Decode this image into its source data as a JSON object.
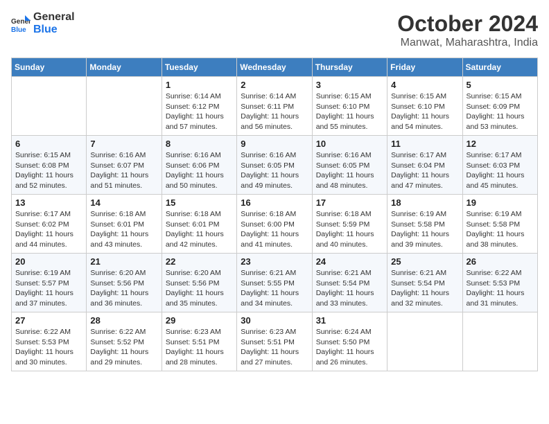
{
  "header": {
    "logo_line1": "General",
    "logo_line2": "Blue",
    "month": "October 2024",
    "location": "Manwat, Maharashtra, India"
  },
  "weekdays": [
    "Sunday",
    "Monday",
    "Tuesday",
    "Wednesday",
    "Thursday",
    "Friday",
    "Saturday"
  ],
  "weeks": [
    [
      null,
      null,
      {
        "day": "1",
        "sunrise": "6:14 AM",
        "sunset": "6:12 PM",
        "daylight": "11 hours and 57 minutes."
      },
      {
        "day": "2",
        "sunrise": "6:14 AM",
        "sunset": "6:11 PM",
        "daylight": "11 hours and 56 minutes."
      },
      {
        "day": "3",
        "sunrise": "6:15 AM",
        "sunset": "6:10 PM",
        "daylight": "11 hours and 55 minutes."
      },
      {
        "day": "4",
        "sunrise": "6:15 AM",
        "sunset": "6:10 PM",
        "daylight": "11 hours and 54 minutes."
      },
      {
        "day": "5",
        "sunrise": "6:15 AM",
        "sunset": "6:09 PM",
        "daylight": "11 hours and 53 minutes."
      }
    ],
    [
      {
        "day": "6",
        "sunrise": "6:15 AM",
        "sunset": "6:08 PM",
        "daylight": "11 hours and 52 minutes."
      },
      {
        "day": "7",
        "sunrise": "6:16 AM",
        "sunset": "6:07 PM",
        "daylight": "11 hours and 51 minutes."
      },
      {
        "day": "8",
        "sunrise": "6:16 AM",
        "sunset": "6:06 PM",
        "daylight": "11 hours and 50 minutes."
      },
      {
        "day": "9",
        "sunrise": "6:16 AM",
        "sunset": "6:05 PM",
        "daylight": "11 hours and 49 minutes."
      },
      {
        "day": "10",
        "sunrise": "6:16 AM",
        "sunset": "6:05 PM",
        "daylight": "11 hours and 48 minutes."
      },
      {
        "day": "11",
        "sunrise": "6:17 AM",
        "sunset": "6:04 PM",
        "daylight": "11 hours and 47 minutes."
      },
      {
        "day": "12",
        "sunrise": "6:17 AM",
        "sunset": "6:03 PM",
        "daylight": "11 hours and 45 minutes."
      }
    ],
    [
      {
        "day": "13",
        "sunrise": "6:17 AM",
        "sunset": "6:02 PM",
        "daylight": "11 hours and 44 minutes."
      },
      {
        "day": "14",
        "sunrise": "6:18 AM",
        "sunset": "6:01 PM",
        "daylight": "11 hours and 43 minutes."
      },
      {
        "day": "15",
        "sunrise": "6:18 AM",
        "sunset": "6:01 PM",
        "daylight": "11 hours and 42 minutes."
      },
      {
        "day": "16",
        "sunrise": "6:18 AM",
        "sunset": "6:00 PM",
        "daylight": "11 hours and 41 minutes."
      },
      {
        "day": "17",
        "sunrise": "6:18 AM",
        "sunset": "5:59 PM",
        "daylight": "11 hours and 40 minutes."
      },
      {
        "day": "18",
        "sunrise": "6:19 AM",
        "sunset": "5:58 PM",
        "daylight": "11 hours and 39 minutes."
      },
      {
        "day": "19",
        "sunrise": "6:19 AM",
        "sunset": "5:58 PM",
        "daylight": "11 hours and 38 minutes."
      }
    ],
    [
      {
        "day": "20",
        "sunrise": "6:19 AM",
        "sunset": "5:57 PM",
        "daylight": "11 hours and 37 minutes."
      },
      {
        "day": "21",
        "sunrise": "6:20 AM",
        "sunset": "5:56 PM",
        "daylight": "11 hours and 36 minutes."
      },
      {
        "day": "22",
        "sunrise": "6:20 AM",
        "sunset": "5:56 PM",
        "daylight": "11 hours and 35 minutes."
      },
      {
        "day": "23",
        "sunrise": "6:21 AM",
        "sunset": "5:55 PM",
        "daylight": "11 hours and 34 minutes."
      },
      {
        "day": "24",
        "sunrise": "6:21 AM",
        "sunset": "5:54 PM",
        "daylight": "11 hours and 33 minutes."
      },
      {
        "day": "25",
        "sunrise": "6:21 AM",
        "sunset": "5:54 PM",
        "daylight": "11 hours and 32 minutes."
      },
      {
        "day": "26",
        "sunrise": "6:22 AM",
        "sunset": "5:53 PM",
        "daylight": "11 hours and 31 minutes."
      }
    ],
    [
      {
        "day": "27",
        "sunrise": "6:22 AM",
        "sunset": "5:53 PM",
        "daylight": "11 hours and 30 minutes."
      },
      {
        "day": "28",
        "sunrise": "6:22 AM",
        "sunset": "5:52 PM",
        "daylight": "11 hours and 29 minutes."
      },
      {
        "day": "29",
        "sunrise": "6:23 AM",
        "sunset": "5:51 PM",
        "daylight": "11 hours and 28 minutes."
      },
      {
        "day": "30",
        "sunrise": "6:23 AM",
        "sunset": "5:51 PM",
        "daylight": "11 hours and 27 minutes."
      },
      {
        "day": "31",
        "sunrise": "6:24 AM",
        "sunset": "5:50 PM",
        "daylight": "11 hours and 26 minutes."
      },
      null,
      null
    ]
  ]
}
